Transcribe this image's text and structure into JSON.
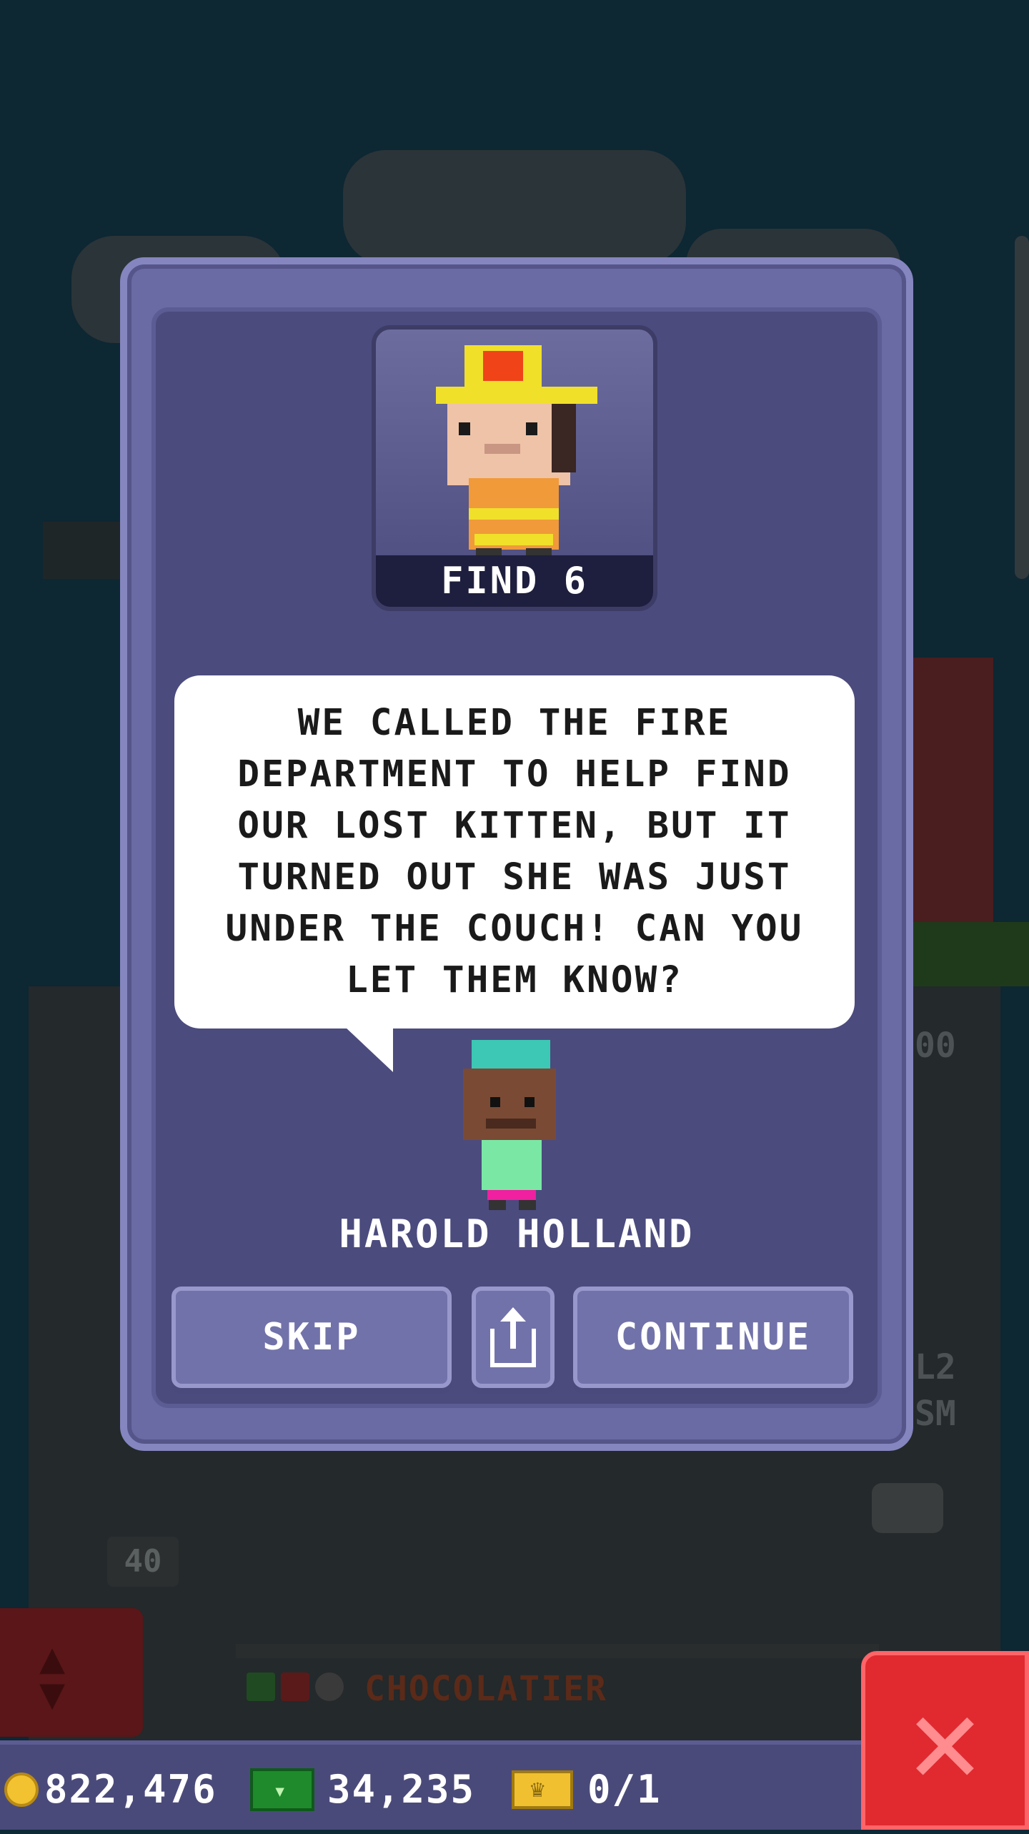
{
  "mission": {
    "objective": "FIND 6",
    "message": "WE CALLED THE FIRE DEPARTMENT TO HELP FIND OUR LOST KITTEN, BUT IT TURNED OUT SHE WAS JUST UNDER THE COUCH! CAN YOU LET THEM KNOW?",
    "npc_name": "HAROLD HOLLAND",
    "buttons": {
      "skip": "SKIP",
      "continue": "CONTINUE",
      "share_icon": "share-icon"
    }
  },
  "background": {
    "floor_number": "40",
    "shop_name": "CHOCOLATIER",
    "right_label_top": "00",
    "right_label_mid1": "L2",
    "right_label_mid2": "SM"
  },
  "status_bar": {
    "coins": "822,476",
    "bux": "34,235",
    "tickets": "0/1"
  },
  "colors": {
    "dialog": "#6a6aa4",
    "dialog_inner": "#4b4b7e",
    "close_button": "#e02a2f",
    "status_bar": "#4a4a7a"
  }
}
